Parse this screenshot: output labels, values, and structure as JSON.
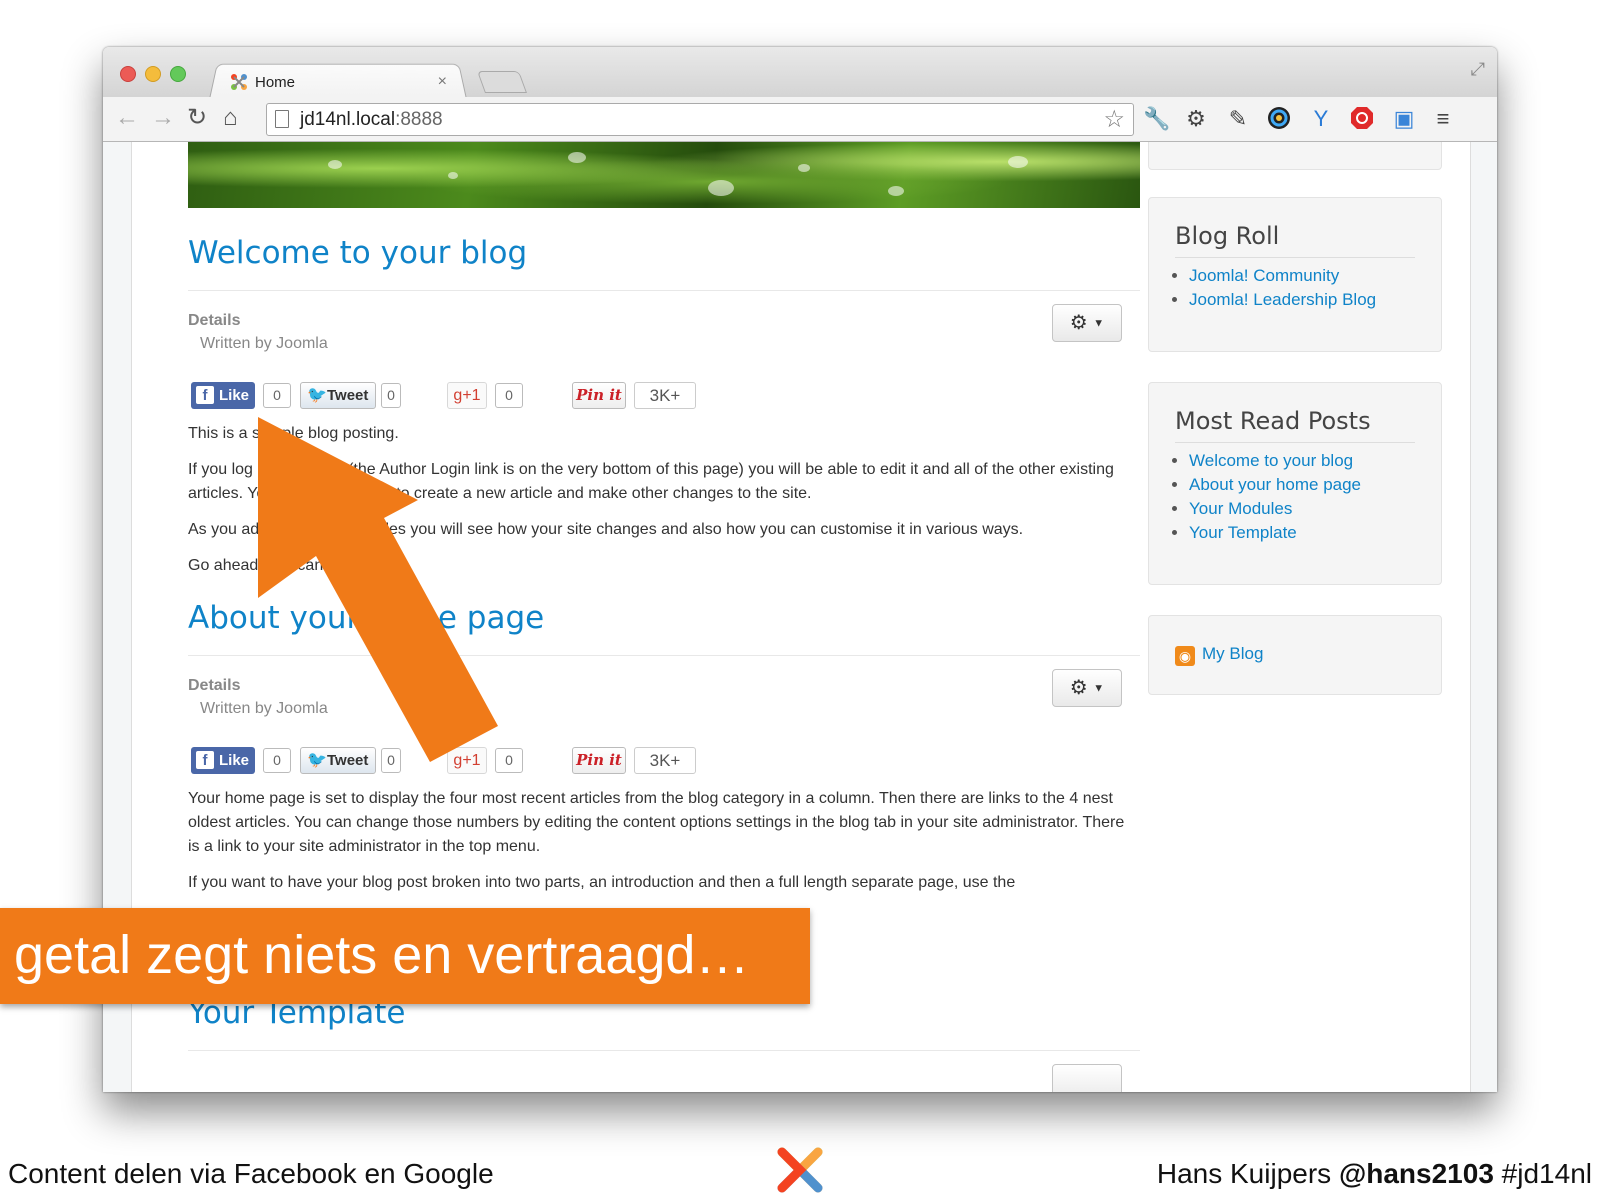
{
  "browser": {
    "tab_title": "Home",
    "tab_close": "×",
    "url_host": "jd14nl.local",
    "url_port": ":8888"
  },
  "articles": [
    {
      "title": "Welcome to your blog",
      "details": "Details",
      "written_by": "Written by Joomla",
      "paragraphs": [
        "This is a sample blog posting.",
        "If you log in to the site (the Author Login link is on the very bottom of this page) you will be able to edit it and all of the other existing articles. You will also be able to create a new article and make other changes to the site.",
        "As you add and modify articles you will see how your site changes and also how you can customise it in various ways.",
        "Go ahead, you can't break it."
      ]
    },
    {
      "title": "About your home page",
      "details": "Details",
      "written_by": "Written by Joomla",
      "paragraphs": [
        "Your home page is set to display the four most recent articles from the blog category in a column. Then there are links to the 4 nest oldest articles. You can change those numbers by editing the content options settings in the blog tab in your site administrator. There is a link to your site administrator in the top menu.",
        "If you want to have your blog post broken into two parts, an introduction and then a full length separate page, use the"
      ]
    },
    {
      "title": "Your Template"
    }
  ],
  "social": {
    "like_label": "Like",
    "like_count": "0",
    "tweet_label": "Tweet",
    "tweet_count": "0",
    "gplus_label": "+1",
    "gplus_count": "0",
    "pinit_label": "Pin it",
    "pin_count": "3K+"
  },
  "sidebar": {
    "blog_roll": {
      "title": "Blog Roll",
      "links": [
        "Joomla! Community",
        "Joomla! Leadership Blog"
      ]
    },
    "most_read": {
      "title": "Most Read Posts",
      "links": [
        "Welcome to your blog",
        "About your home page",
        "Your Modules",
        "Your Template"
      ]
    },
    "feed": {
      "label": "My Blog"
    }
  },
  "slide": {
    "banner": "getal zegt niets en vertraagd…",
    "footer_left": "Content delen via Facebook en Google",
    "footer_author": "Hans Kuijpers ",
    "footer_handle": "@hans2103",
    "footer_tag": " #jd14nl"
  },
  "colors": {
    "accent_orange": "#f07a18",
    "link_blue": "#0f83c8"
  }
}
